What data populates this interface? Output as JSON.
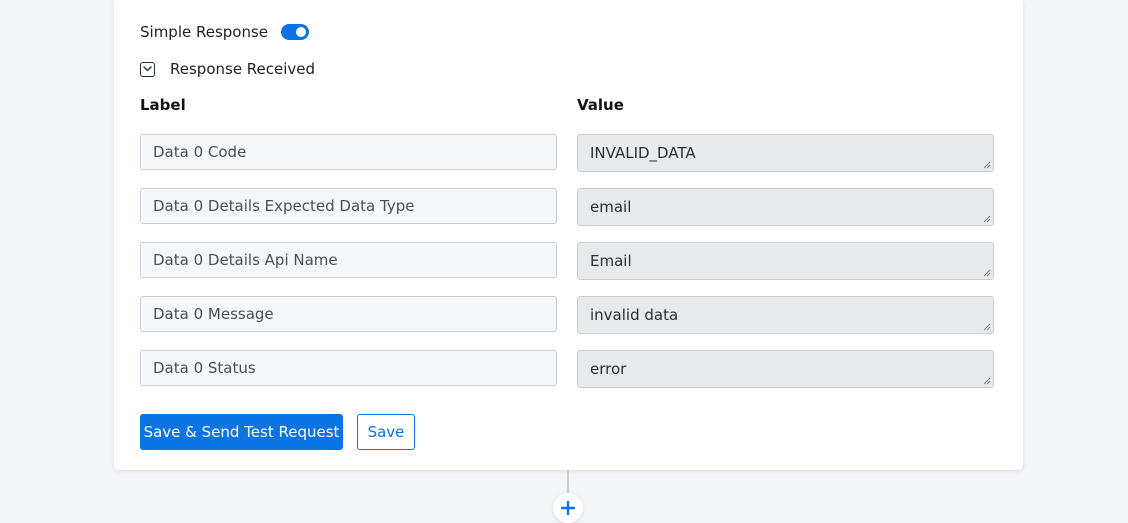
{
  "simple_response": {
    "label": "Simple Response",
    "enabled": true
  },
  "response_received": {
    "label": "Response Received",
    "icon": "chevron-down-icon"
  },
  "columns": {
    "label": "Label",
    "value": "Value"
  },
  "rows": [
    {
      "label": "Data 0 Code",
      "value": "INVALID_DATA"
    },
    {
      "label": "Data 0 Details Expected Data Type",
      "value": "email"
    },
    {
      "label": "Data 0 Details Api Name",
      "value": "Email"
    },
    {
      "label": "Data 0 Message",
      "value": "invalid data"
    },
    {
      "label": "Data 0 Status",
      "value": "error"
    }
  ],
  "actions": {
    "save_send_label": "Save & Send Test Request",
    "save_label": "Save"
  },
  "add_step": {
    "icon": "plus-icon"
  },
  "colors": {
    "accent": "#0b74e5",
    "background": "#f3f5f8"
  }
}
